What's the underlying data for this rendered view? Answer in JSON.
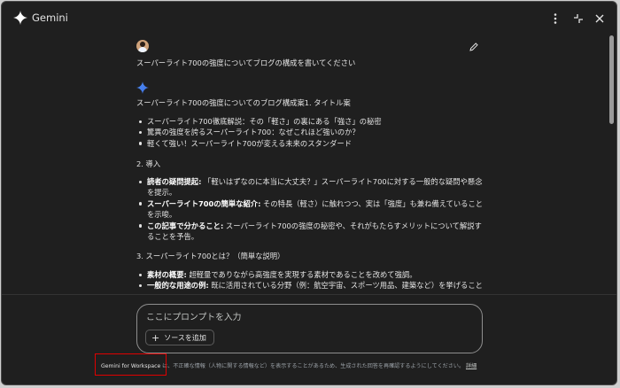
{
  "window": {
    "title": "Gemini"
  },
  "conversation": {
    "user_prompt": "スーパーライト700の強度についてブログの構成を書いてください",
    "response": {
      "heading": "スーパーライト700の強度についてのブログ構成案1. タイトル案",
      "title_ideas": [
        "スーパーライト700徹底解説：その「軽さ」の裏にある「強さ」の秘密",
        "驚異の強度を誇るスーパーライト700：なぜこれほど強いのか？",
        "軽くて強い！スーパーライト700が変える未来のスタンダード"
      ],
      "section2_title": "2. 導入",
      "section2_items": [
        {
          "bold": "読者の疑問提起:",
          "text": " 「軽いはずなのに本当に大丈夫？」スーパーライト700に対する一般的な疑問や懸念を提示。"
        },
        {
          "bold": "スーパーライト700の簡単な紹介:",
          "text": " その特長（軽さ）に触れつつ、実は「強度」も兼ね備えていることを示唆。"
        },
        {
          "bold": "この記事で分かること:",
          "text": " スーパーライト700の強度の秘密や、それがもたらすメリットについて解説することを予告。"
        }
      ],
      "section3_title": "3. スーパーライト700とは？（簡単な説明）",
      "section3_items": [
        {
          "bold": "素材の概要:",
          "text": " 超軽量でありながら高強度を実現する素材であることを改めて強調。"
        },
        {
          "bold": "一般的な用途の例:",
          "text": " 既に活用されている分野（例：航空宇宙、スポーツ用品、建築など）を挙げることで、その信頼性を示す。"
        }
      ]
    }
  },
  "input": {
    "placeholder": "ここにプロンプトを入力",
    "add_source_label": "ソースを追加"
  },
  "footer": {
    "brand": "Gemini for Workspace",
    "disclaimer": " は、不正確な情報（人物に関する情報など）を表示することがあるため、生成された回答を再確認するようにしてください。",
    "details_link": "詳細"
  },
  "colors": {
    "background": "#1f1f1f",
    "text": "#e3e3e3",
    "accent_blue": "#4c8df6",
    "highlight_red": "#e00000"
  },
  "icons": [
    "gemini-logo-icon",
    "more-vert-icon",
    "minimize-icon",
    "close-icon",
    "edit-icon",
    "gemini-spark-icon",
    "plus-icon"
  ]
}
